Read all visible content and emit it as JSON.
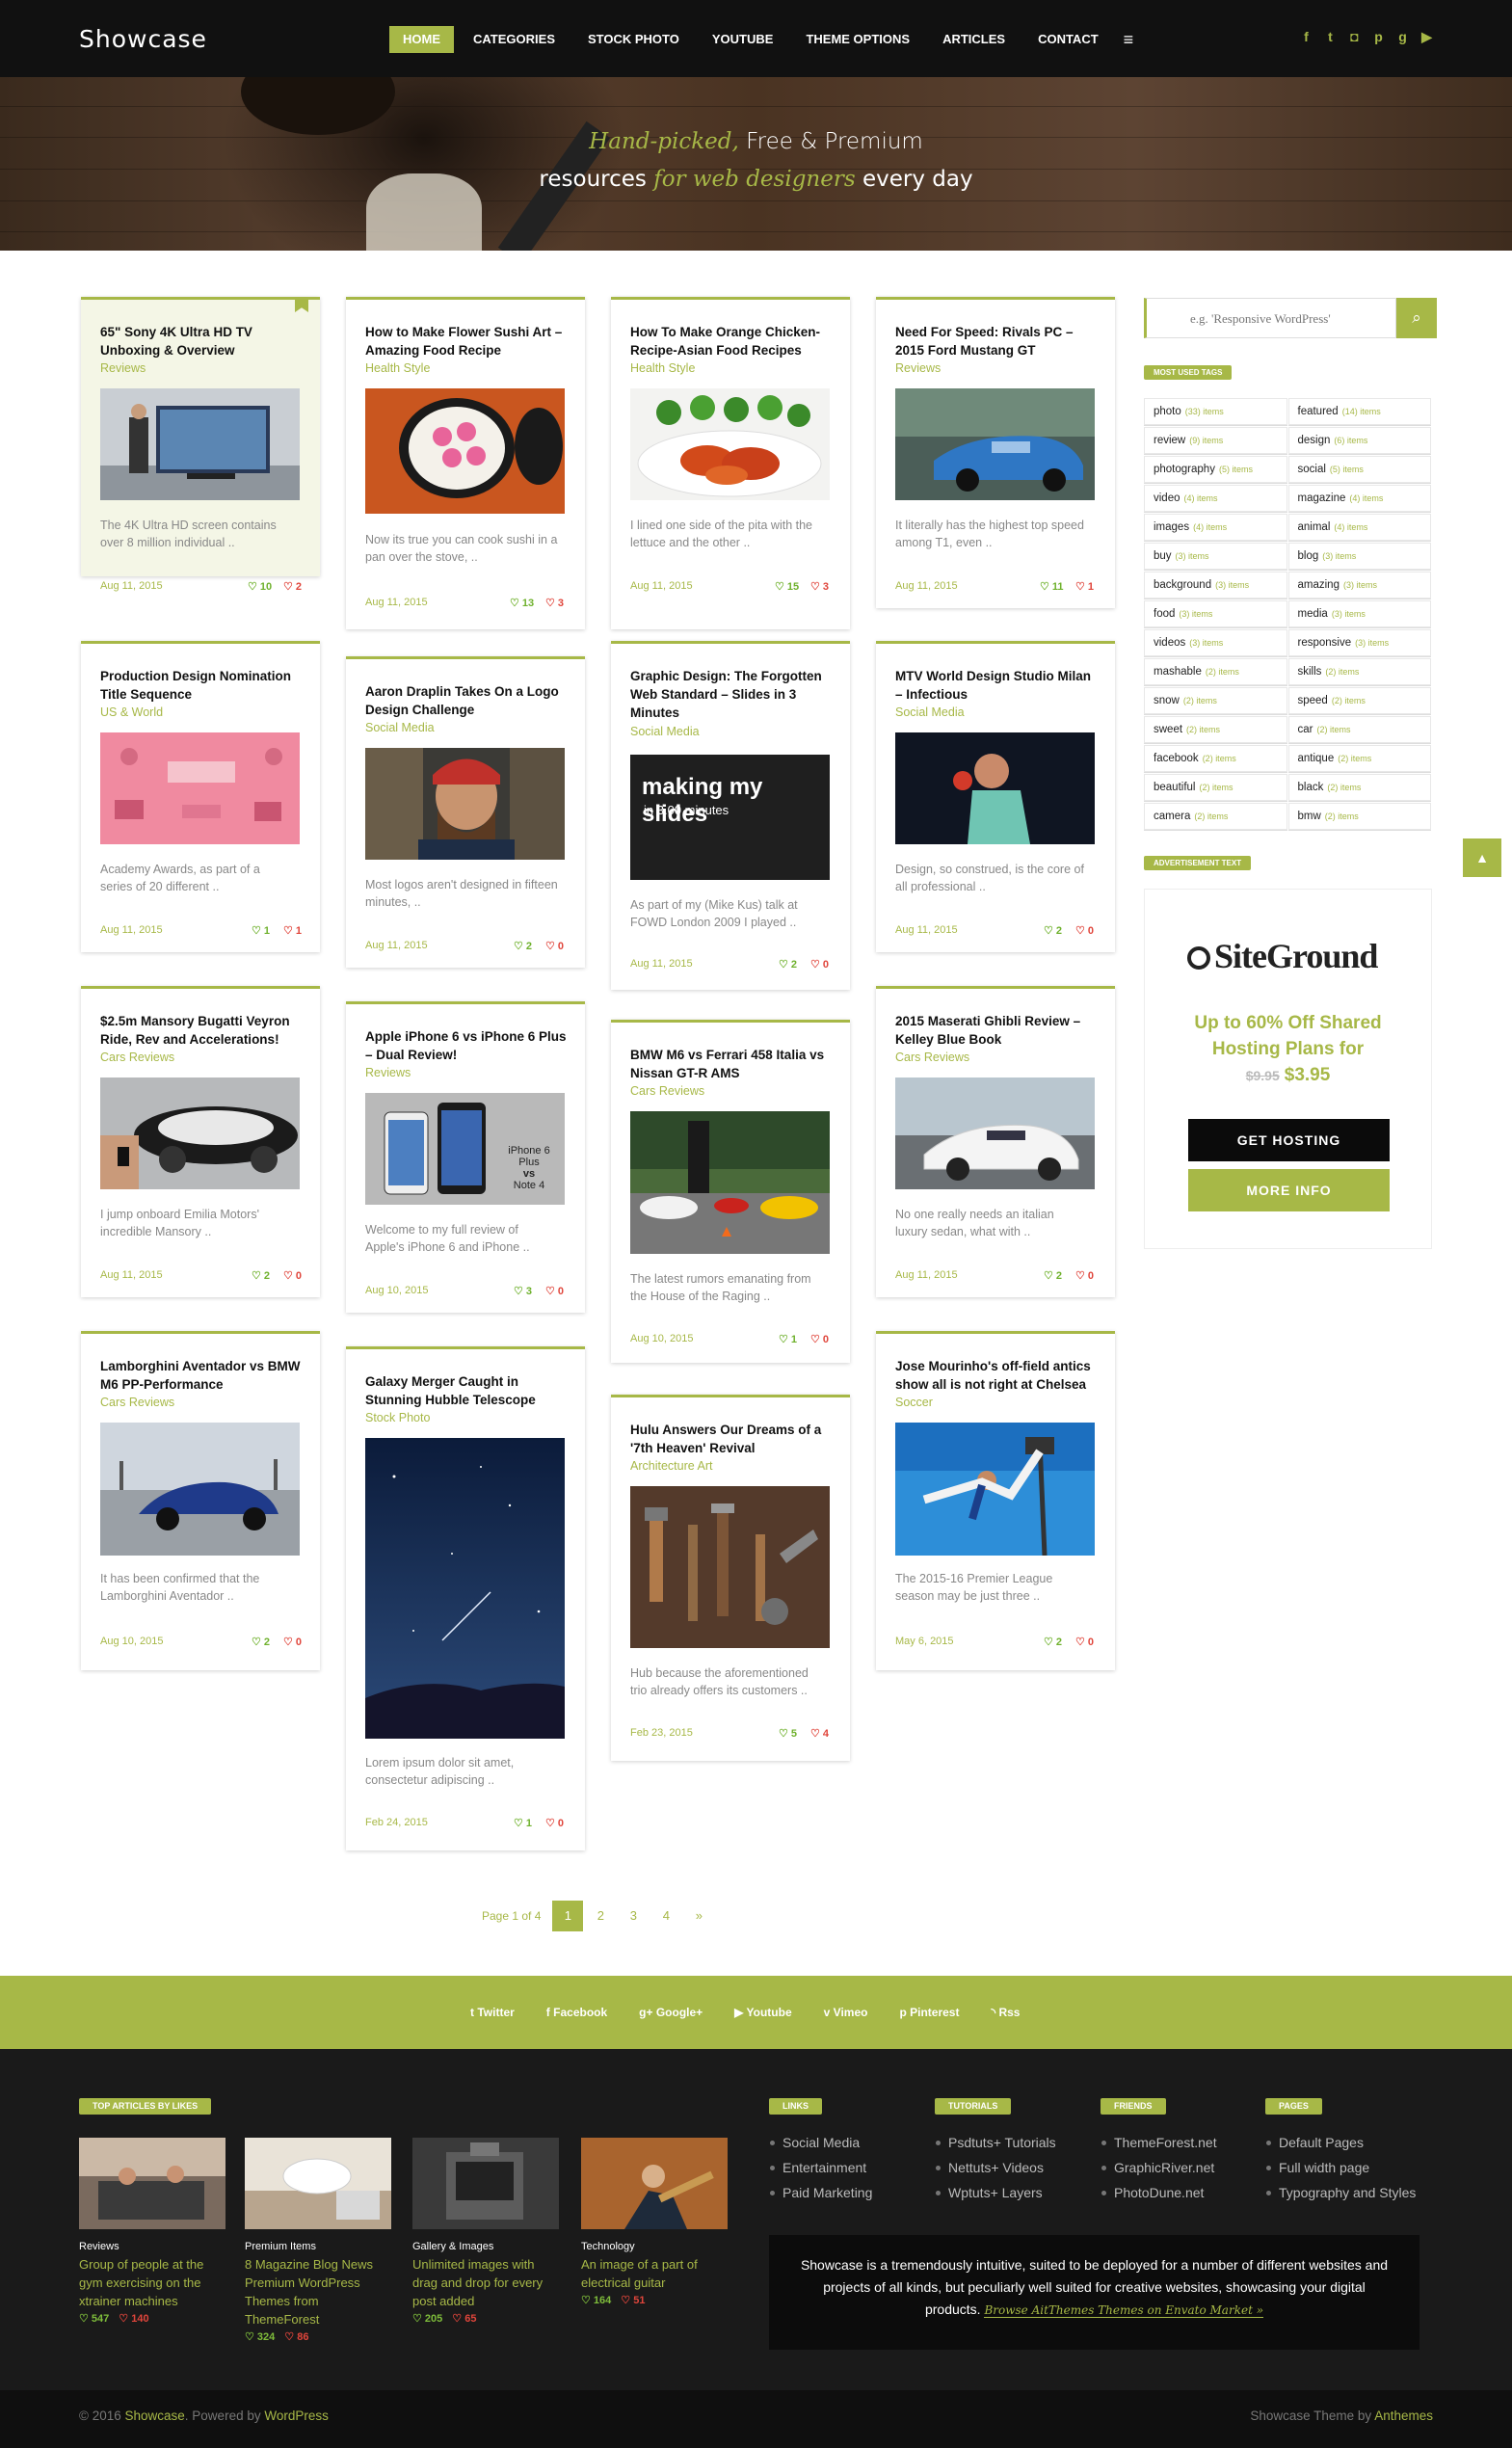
{
  "header": {
    "logo": "Showcase",
    "nav": [
      "HOME",
      "CATEGORIES",
      "STOCK PHOTO",
      "YOUTUBE",
      "THEME OPTIONS",
      "ARTICLES",
      "CONTACT"
    ],
    "social_icons": [
      "facebook-icon",
      "twitter-icon",
      "instagram-icon",
      "pinterest-icon",
      "google-plus-icon",
      "youtube-icon"
    ]
  },
  "hero": {
    "l1a": "Hand-picked,",
    "l1b": "Free & Premium",
    "l2a": "resources",
    "l2b": "for web designers",
    "l2c": "every day"
  },
  "posts": [
    {
      "title": "65\" Sony 4K Ultra HD TV Unboxing & Overview",
      "cat": "Reviews",
      "excerpt": "The 4K Ultra HD screen contains over 8 million individual ..",
      "date": "Aug 11, 2015",
      "likes": "10",
      "dislikes": "2"
    },
    {
      "title": "How to Make Flower Sushi Art – Amazing Food Recipe",
      "cat": "Health Style",
      "excerpt": "Now its true you can cook sushi in a pan over the stove, ..",
      "date": "Aug 11, 2015",
      "likes": "13",
      "dislikes": "3"
    },
    {
      "title": "How To Make Orange Chicken-Recipe-Asian Food Recipes",
      "cat": "Health Style",
      "excerpt": "I lined one side of the pita with the lettuce and the other ..",
      "date": "Aug 11, 2015",
      "likes": "15",
      "dislikes": "3"
    },
    {
      "title": "Need For Speed: Rivals PC – 2015 Ford Mustang GT",
      "cat": "Reviews",
      "excerpt": "It literally has the highest top speed among T1, even ..",
      "date": "Aug 11, 2015",
      "likes": "11",
      "dislikes": "1"
    },
    {
      "title": "Production Design Nomination Title Sequence",
      "cat": "US & World",
      "excerpt": "Academy Awards, as part of a series of 20 different ..",
      "date": "Aug 11, 2015",
      "likes": "1",
      "dislikes": "1"
    },
    {
      "title": "Aaron Draplin Takes On a Logo Design Challenge",
      "cat": "Social Media",
      "excerpt": "Most logos aren't designed in fifteen minutes, ..",
      "date": "Aug 11, 2015",
      "likes": "2",
      "dislikes": "0"
    },
    {
      "title": "Graphic Design: The Forgotten Web Standard – Slides in 3 Minutes",
      "cat": "Social Media",
      "excerpt": "As part of my (Mike Kus) talk at FOWD London 2009 I played ..",
      "date": "Aug 11, 2015",
      "likes": "2",
      "dislikes": "0",
      "img_text": "making my slides",
      "img_sub": "in 3.00 minutes"
    },
    {
      "title": "MTV World Design Studio Milan – Infectious",
      "cat": "Social Media",
      "excerpt": "Design, so construed, is the core of all professional ..",
      "date": "Aug 11, 2015",
      "likes": "2",
      "dislikes": "0"
    },
    {
      "title": "$2.5m Mansory Bugatti Veyron Ride, Rev and Accelerations!",
      "cat": "Cars Reviews",
      "excerpt": "I jump onboard Emilia Motors' incredible Mansory ..",
      "date": "Aug 11, 2015",
      "likes": "2",
      "dislikes": "0"
    },
    {
      "title": "Apple iPhone 6 vs iPhone 6 Plus – Dual Review!",
      "cat": "Reviews",
      "excerpt": "Welcome to my full review of Apple's iPhone 6 and iPhone ..",
      "date": "Aug 10, 2015",
      "likes": "3",
      "dislikes": "0",
      "img_text": "iPhone 6 Plus",
      "img_sub": "vs",
      "img_sub2": "Note 4"
    },
    {
      "title": "BMW M6 vs Ferrari 458 Italia vs Nissan GT-R AMS",
      "cat": "Cars Reviews",
      "excerpt": "The latest rumors emanating from the House of the Raging ..",
      "date": "Aug 10, 2015",
      "likes": "1",
      "dislikes": "0"
    },
    {
      "title": "2015 Maserati Ghibli Review – Kelley Blue Book",
      "cat": "Cars Reviews",
      "excerpt": "No one really needs an italian luxury sedan, what with ..",
      "date": "Aug 11, 2015",
      "likes": "2",
      "dislikes": "0"
    },
    {
      "title": "Lamborghini Aventador vs BMW M6 PP-Performance",
      "cat": "Cars Reviews",
      "excerpt": "It has been confirmed that the Lamborghini Aventador ..",
      "date": "Aug 10, 2015",
      "likes": "2",
      "dislikes": "0"
    },
    {
      "title": "Galaxy Merger Caught in Stunning Hubble Telescope",
      "cat": "Stock Photo",
      "excerpt": "Lorem ipsum dolor sit amet, consectetur adipiscing ..",
      "date": "Feb 24, 2015",
      "likes": "1",
      "dislikes": "0"
    },
    {
      "title": "Hulu Answers Our Dreams of a '7th Heaven' Revival",
      "cat": "Architecture Art",
      "excerpt": "Hub because the aforementioned trio already offers its customers ..",
      "date": "Feb 23, 2015",
      "likes": "5",
      "dislikes": "4"
    },
    {
      "title": "Jose Mourinho's off-field antics show all is not right at Chelsea",
      "cat": "Soccer",
      "excerpt": "The 2015-16 Premier League season may be just three ..",
      "date": "May 6, 2015",
      "likes": "2",
      "dislikes": "0"
    }
  ],
  "sidebar": {
    "search_placeholder": "e.g. 'Responsive WordPress'",
    "tags_title": "MOST USED TAGS",
    "tags": [
      [
        "photo",
        "(33) items"
      ],
      [
        "featured",
        "(14) items"
      ],
      [
        "review",
        "(9) items"
      ],
      [
        "design",
        "(6) items"
      ],
      [
        "photography",
        "(5) items"
      ],
      [
        "social",
        "(5) items"
      ],
      [
        "video",
        "(4) items"
      ],
      [
        "magazine",
        "(4) items"
      ],
      [
        "images",
        "(4) items"
      ],
      [
        "animal",
        "(4) items"
      ],
      [
        "buy",
        "(3) items"
      ],
      [
        "blog",
        "(3) items"
      ],
      [
        "background",
        "(3) items"
      ],
      [
        "amazing",
        "(3) items"
      ],
      [
        "food",
        "(3) items"
      ],
      [
        "media",
        "(3) items"
      ],
      [
        "videos",
        "(3) items"
      ],
      [
        "responsive",
        "(3) items"
      ],
      [
        "mashable",
        "(2) items"
      ],
      [
        "skills",
        "(2) items"
      ],
      [
        "snow",
        "(2) items"
      ],
      [
        "speed",
        "(2) items"
      ],
      [
        "sweet",
        "(2) items"
      ],
      [
        "car",
        "(2) items"
      ],
      [
        "facebook",
        "(2) items"
      ],
      [
        "antique",
        "(2) items"
      ],
      [
        "beautiful",
        "(2) items"
      ],
      [
        "black",
        "(2) items"
      ],
      [
        "camera",
        "(2) items"
      ],
      [
        "bmw",
        "(2) items"
      ]
    ],
    "ad_title": "ADVERTISEMENT TEXT",
    "ad_logo": "SiteGround",
    "ad_head": "Up to 60% Off Shared Hosting Plans for",
    "ad_old": "$9.95",
    "ad_price": "$3.95",
    "ad_btn1": "GET HOSTING",
    "ad_btn2": "MORE INFO"
  },
  "pagination": {
    "label": "Page 1 of 4",
    "pages": [
      "1",
      "2",
      "3",
      "4",
      "»"
    ]
  },
  "strip_links": [
    "Twitter",
    "Facebook",
    "Google+",
    "Youtube",
    "Vimeo",
    "Pinterest",
    "Rss"
  ],
  "footer": {
    "top_title": "TOP ARTICLES BY LIKES",
    "articles": [
      {
        "cat": "Reviews",
        "title": "Group of people at the gym exercising on the xtrainer machines",
        "likes": "547",
        "dislikes": "140"
      },
      {
        "cat": "Premium Items",
        "title": "8 Magazine Blog News Premium WordPress Themes from ThemeForest",
        "likes": "324",
        "dislikes": "86"
      },
      {
        "cat": "Gallery & Images",
        "title": "Unlimited images with drag and drop for every post added",
        "likes": "205",
        "dislikes": "65"
      },
      {
        "cat": "Technology",
        "title": "An image of a part of electrical guitar",
        "likes": "164",
        "dislikes": "51"
      }
    ],
    "cols": [
      {
        "title": "LINKS",
        "items": [
          "Social Media",
          "Entertainment",
          "Paid Marketing"
        ]
      },
      {
        "title": "TUTORIALS",
        "items": [
          "Psdtuts+ Tutorials",
          "Nettuts+ Videos",
          "Wptuts+ Layers"
        ]
      },
      {
        "title": "FRIENDS",
        "items": [
          "ThemeForest.net",
          "GraphicRiver.net",
          "PhotoDune.net"
        ]
      },
      {
        "title": "PAGES",
        "items": [
          "Default Pages",
          "Full width page",
          "Typography and Styles"
        ]
      }
    ],
    "about": "Showcase is a tremendously intuitive, suited to be deployed for a number of different websites and projects of all kinds, but peculiarly well suited for creative websites, showcasing your digital products.",
    "about_link": "Browse AitThemes Themes on Envato Market »",
    "copy_pre": "© 2016",
    "copy_name": "Showcase",
    "copy_mid": ". Powered by",
    "copy_wp": "WordPress",
    "credit_pre": "Showcase Theme by",
    "credit_name": "Anthemes"
  }
}
